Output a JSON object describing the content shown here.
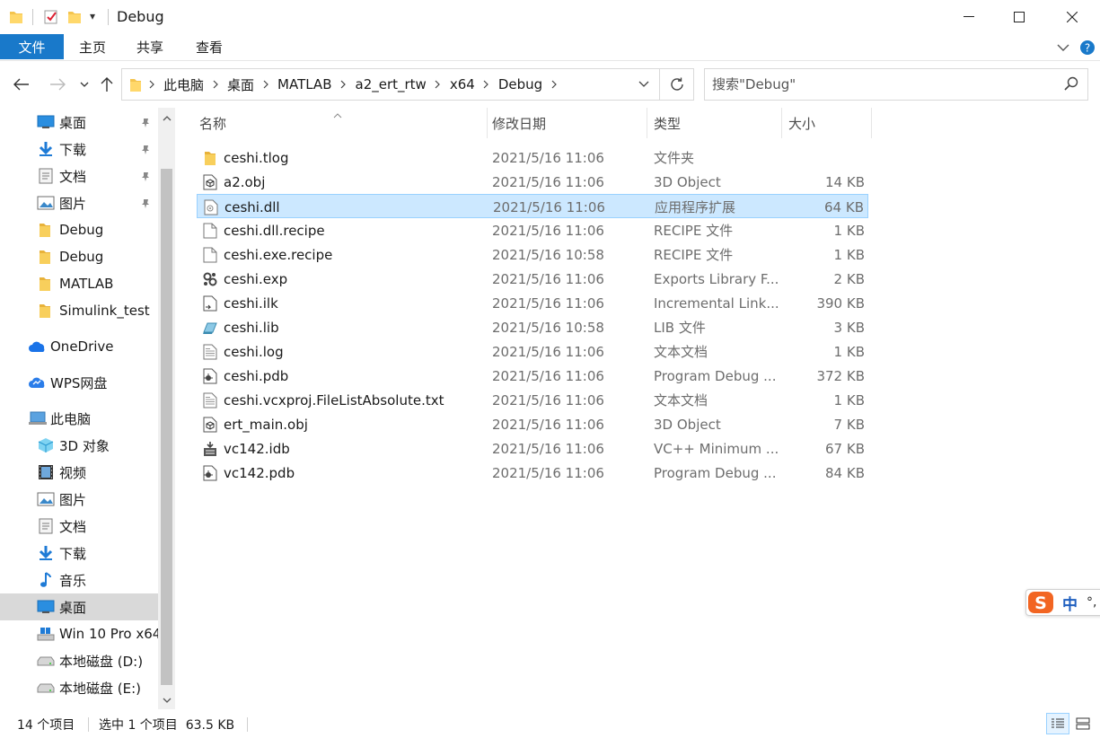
{
  "window": {
    "title": "Debug",
    "qa_menu_glyph": "▾"
  },
  "ribbon": {
    "tabs": [
      "文件",
      "主页",
      "共享",
      "查看"
    ]
  },
  "address": {
    "crumbs": [
      "此电脑",
      "桌面",
      "MATLAB",
      "a2_ert_rtw",
      "x64",
      "Debug"
    ]
  },
  "search": {
    "placeholder": "搜索\"Debug\""
  },
  "sidebar": {
    "quick": [
      {
        "label": "桌面",
        "icon": "desktop-icon",
        "pinned": true
      },
      {
        "label": "下载",
        "icon": "download-icon",
        "pinned": true
      },
      {
        "label": "文档",
        "icon": "document-icon",
        "pinned": true
      },
      {
        "label": "图片",
        "icon": "picture-icon",
        "pinned": true
      },
      {
        "label": "Debug",
        "icon": "folder-icon",
        "pinned": false
      },
      {
        "label": "Debug",
        "icon": "folder-icon",
        "pinned": false
      },
      {
        "label": "MATLAB",
        "icon": "folder-icon",
        "pinned": false
      },
      {
        "label": "Simulink_test",
        "icon": "folder-icon",
        "pinned": false
      }
    ],
    "onedrive": "OneDrive",
    "wps": "WPS网盘",
    "pc": "此电脑",
    "pc_items": [
      {
        "label": "3D 对象",
        "icon": "3d-objects-icon"
      },
      {
        "label": "视频",
        "icon": "video-icon"
      },
      {
        "label": "图片",
        "icon": "picture-icon"
      },
      {
        "label": "文档",
        "icon": "document-icon"
      },
      {
        "label": "下载",
        "icon": "download-icon"
      },
      {
        "label": "音乐",
        "icon": "music-icon"
      },
      {
        "label": "桌面",
        "icon": "desktop-icon",
        "selected": true
      },
      {
        "label": "Win 10 Pro x64",
        "icon": "windows-drive-icon"
      },
      {
        "label": "本地磁盘 (D:)",
        "icon": "drive-icon"
      },
      {
        "label": "本地磁盘 (E:)",
        "icon": "drive-icon"
      }
    ]
  },
  "columns": {
    "name": "名称",
    "date": "修改日期",
    "type": "类型",
    "size": "大小"
  },
  "files": [
    {
      "name": "ceshi.tlog",
      "date": "2021/5/16 11:06",
      "type": "文件夹",
      "size": "",
      "icon": "folder-icon"
    },
    {
      "name": "a2.obj",
      "date": "2021/5/16 11:06",
      "type": "3D Object",
      "size": "14 KB",
      "icon": "3d-object-file-icon"
    },
    {
      "name": "ceshi.dll",
      "date": "2021/5/16 11:06",
      "type": "应用程序扩展",
      "size": "64 KB",
      "icon": "dll-file-icon",
      "selected": true
    },
    {
      "name": "ceshi.dll.recipe",
      "date": "2021/5/16 11:06",
      "type": "RECIPE 文件",
      "size": "1 KB",
      "icon": "blank-file-icon"
    },
    {
      "name": "ceshi.exe.recipe",
      "date": "2021/5/16 10:58",
      "type": "RECIPE 文件",
      "size": "1 KB",
      "icon": "blank-file-icon"
    },
    {
      "name": "ceshi.exp",
      "date": "2021/5/16 11:06",
      "type": "Exports Library F...",
      "size": "2 KB",
      "icon": "gears-file-icon"
    },
    {
      "name": "ceshi.ilk",
      "date": "2021/5/16 11:06",
      "type": "Incremental Link...",
      "size": "390 KB",
      "icon": "link-file-icon"
    },
    {
      "name": "ceshi.lib",
      "date": "2021/5/16 10:58",
      "type": "LIB 文件",
      "size": "3 KB",
      "icon": "lib-file-icon"
    },
    {
      "name": "ceshi.log",
      "date": "2021/5/16 11:06",
      "type": "文本文档",
      "size": "1 KB",
      "icon": "text-file-icon"
    },
    {
      "name": "ceshi.pdb",
      "date": "2021/5/16 11:06",
      "type": "Program Debug ...",
      "size": "372 KB",
      "icon": "pdb-file-icon"
    },
    {
      "name": "ceshi.vcxproj.FileListAbsolute.txt",
      "date": "2021/5/16 11:06",
      "type": "文本文档",
      "size": "1 KB",
      "icon": "text-file-icon"
    },
    {
      "name": "ert_main.obj",
      "date": "2021/5/16 11:06",
      "type": "3D Object",
      "size": "7 KB",
      "icon": "3d-object-file-icon"
    },
    {
      "name": "vc142.idb",
      "date": "2021/5/16 11:06",
      "type": "VC++ Minimum ...",
      "size": "67 KB",
      "icon": "idb-file-icon"
    },
    {
      "name": "vc142.pdb",
      "date": "2021/5/16 11:06",
      "type": "Program Debug ...",
      "size": "84 KB",
      "icon": "pdb-file-icon"
    }
  ],
  "status": {
    "count": "14 个项目",
    "selection": "选中 1 个项目  63.5 KB"
  },
  "ime": {
    "logo": "S",
    "mode": "中",
    "punct": "°,"
  },
  "colors": {
    "accent": "#1979ca",
    "selection_bg": "#cce8ff",
    "selection_border": "#99d1ff",
    "folder": "#f4c44e"
  }
}
